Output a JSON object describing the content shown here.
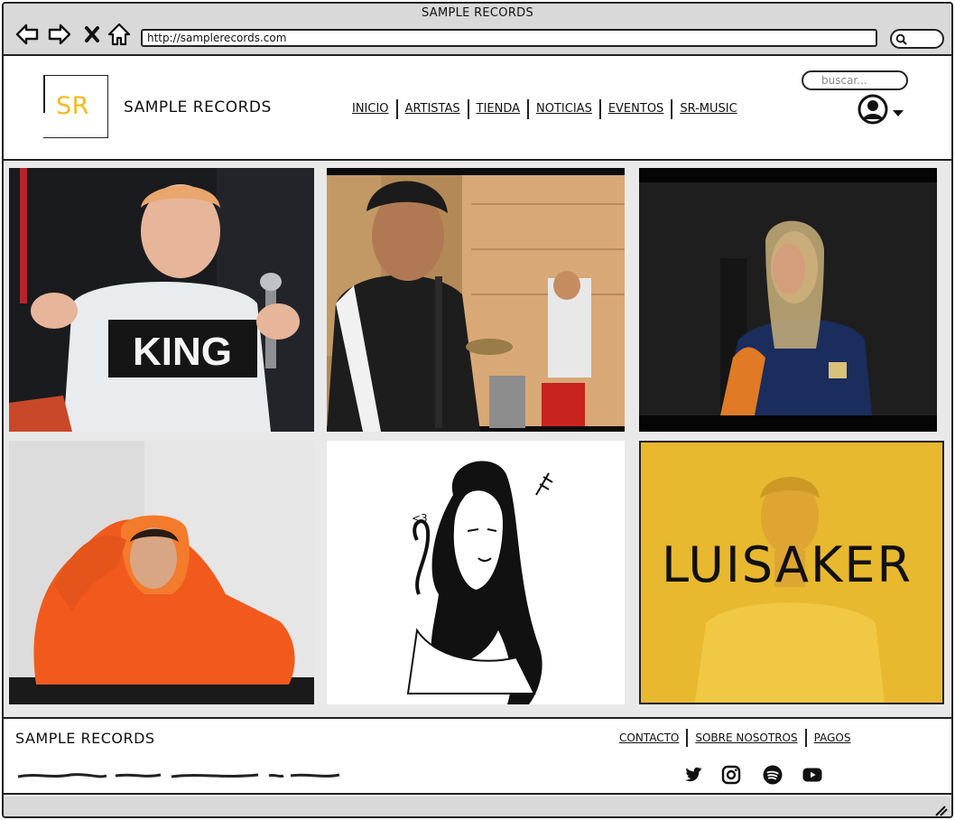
{
  "window": {
    "title": "SAMPLE RECORDS",
    "url": "http://samplerecords.com"
  },
  "header": {
    "logo_text": "SR",
    "brand_name": "SAMPLE RECORDS",
    "nav": [
      "INICIO",
      "ARTISTAS",
      "TIENDA",
      "NOTICIAS",
      "EVENTOS",
      "SR-MUSIC"
    ],
    "search_placeholder": "buscar..."
  },
  "gallery": {
    "tiles": [
      {
        "shirt_text": "KING"
      },
      {},
      {},
      {},
      {},
      {
        "overlay_text": "LUISAKER"
      }
    ]
  },
  "footer": {
    "brand_name": "SAMPLE RECORDS",
    "nav": [
      "CONTACTO",
      "SOBRE NOSOTROS",
      "PAGOS"
    ],
    "social_icons": [
      "twitter-icon",
      "instagram-icon",
      "spotify-icon",
      "youtube-icon"
    ]
  },
  "colors": {
    "brand_yellow": "#f2bb1c",
    "chrome_gray": "#d9d9d9",
    "ink": "#222222"
  }
}
